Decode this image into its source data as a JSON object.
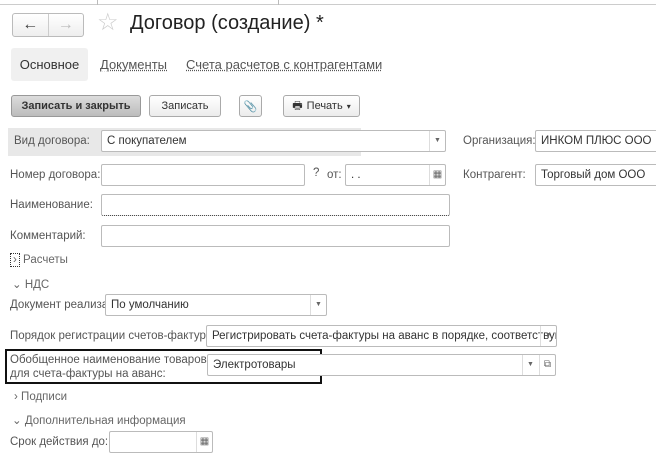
{
  "window": {
    "title": "Договор (создание) *"
  },
  "nav": {
    "back": "←",
    "forward": "→"
  },
  "tabs": [
    {
      "label": "Основное"
    },
    {
      "label": "Документы"
    },
    {
      "label": "Счета расчетов с контрагентами"
    }
  ],
  "toolbar": {
    "save_close": "Записать и закрыть",
    "save": "Записать",
    "print": "Печать",
    "print_arrow": "▾"
  },
  "form": {
    "contract_type": {
      "label": "Вид договора:",
      "value": "С покупателем"
    },
    "organization": {
      "label": "Организация:",
      "value": "ИНКОМ ПЛЮС ООО"
    },
    "number": {
      "label": "Номер договора:",
      "value": "",
      "question": "?",
      "date_label": "от:",
      "date_value": " .  ."
    },
    "counterparty": {
      "label": "Контрагент:",
      "value": "Торговый дом ООО"
    },
    "name": {
      "label": "Наименование:",
      "value": ""
    },
    "comment": {
      "label": "Комментарий:",
      "value": ""
    },
    "settlements": {
      "label": "Расчеты"
    },
    "vat": {
      "label": "НДС"
    },
    "sale_doc": {
      "label": "Документ реализации:",
      "value": "По умолчанию"
    },
    "invoice_order": {
      "label": "Порядок регистрации счетов-фактур:",
      "value": "Регистрировать счета-фактуры на аванс в порядке, соответствующем"
    },
    "generic_name": {
      "label_line1": "Обобщенное наименование товаров",
      "label_line2": "для счета-фактуры на аванс:",
      "value": "Электротовары"
    },
    "signatures": {
      "label": "Подписи"
    },
    "additional": {
      "label": "Дополнительная информация"
    },
    "valid_until": {
      "label": "Срок действия до:",
      "value": ""
    }
  }
}
